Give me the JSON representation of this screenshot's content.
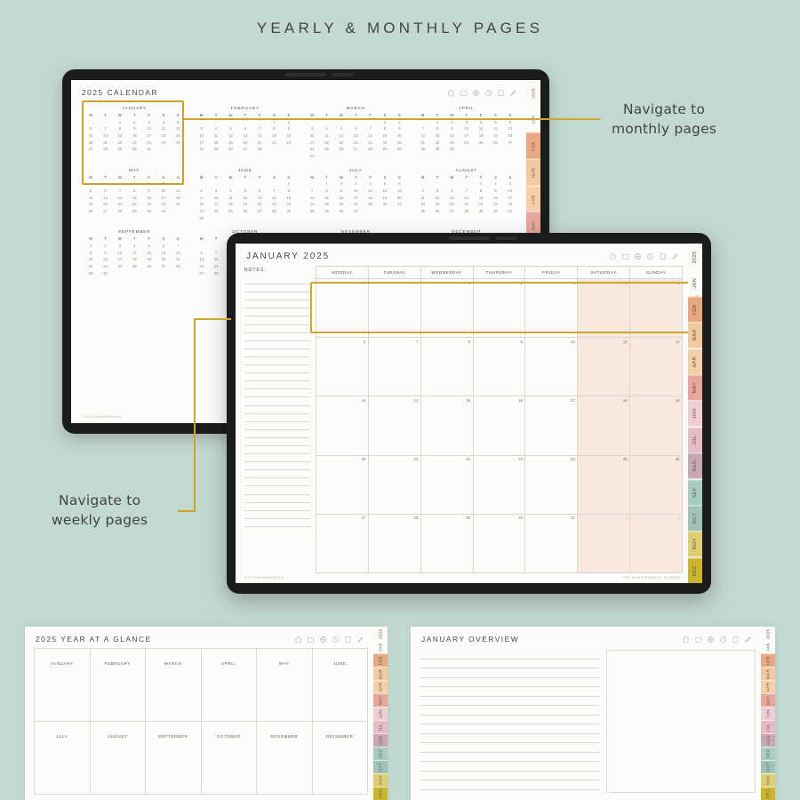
{
  "page": {
    "title": "YEARLY & MONTHLY PAGES",
    "bg_color": "#c3d9d0",
    "accent_gold": "#c9a227",
    "weekend_tint": "#f9e8de"
  },
  "callouts": [
    {
      "line1": "Navigate to",
      "line2": "monthly pages"
    },
    {
      "line1": "Navigate to",
      "line2": "weekly pages"
    }
  ],
  "toolbar_icons": [
    "home-icon",
    "note-icon",
    "globe-icon",
    "clock-icon",
    "book-icon",
    "pencil-icon"
  ],
  "month_tabs": [
    {
      "label": "2025",
      "color": "#fbf9f4"
    },
    {
      "label": "JAN",
      "color": "#fdfcf7"
    },
    {
      "label": "FEB",
      "color": "#e8a882"
    },
    {
      "label": "MAR",
      "color": "#f2c9a0"
    },
    {
      "label": "APR",
      "color": "#f6cfa8"
    },
    {
      "label": "MAY",
      "color": "#e8a79a"
    },
    {
      "label": "JUN",
      "color": "#eecdd4"
    },
    {
      "label": "JUL",
      "color": "#e6bcc6"
    },
    {
      "label": "AUG",
      "color": "#c8a7b4"
    },
    {
      "label": "SEP",
      "color": "#a8ccc2"
    },
    {
      "label": "OCT",
      "color": "#9fc3b8"
    },
    {
      "label": "NOV",
      "color": "#e0cf72"
    },
    {
      "label": "DEC",
      "color": "#cbb42e"
    }
  ],
  "yearly_page": {
    "title": "2025 CALENDAR",
    "copyright": "© SYLVIA MASCHELLA",
    "dow": [
      "M",
      "T",
      "W",
      "T",
      "F",
      "S",
      "S"
    ],
    "months": [
      {
        "name": "JANUARY",
        "lead": 2,
        "days": 31
      },
      {
        "name": "FEBRUARY",
        "lead": 5,
        "days": 28
      },
      {
        "name": "MARCH",
        "lead": 5,
        "days": 31
      },
      {
        "name": "APRIL",
        "lead": 1,
        "days": 30
      },
      {
        "name": "MAY",
        "lead": 3,
        "days": 31
      },
      {
        "name": "JUNE",
        "lead": 6,
        "days": 30
      },
      {
        "name": "JULY",
        "lead": 1,
        "days": 31
      },
      {
        "name": "AUGUST",
        "lead": 4,
        "days": 31
      },
      {
        "name": "SEPTEMBER",
        "lead": 0,
        "days": 30
      },
      {
        "name": "OCTOBER",
        "lead": 2,
        "days": 31
      },
      {
        "name": "NOVEMBER",
        "lead": 5,
        "days": 30
      },
      {
        "name": "DECEMBER",
        "lead": 0,
        "days": 31
      }
    ]
  },
  "monthly_page": {
    "title": "JANUARY 2025",
    "notes_label": "NOTES:",
    "notes_line_count": 31,
    "copyright": "© SYLVIA MASCHELLA",
    "brand": "THE QUINTESSENTIAL PLANNER",
    "dow": [
      "MONDAY",
      "TUESDAY",
      "WEDNESDAY",
      "THURSDAY",
      "FRIDAY",
      "SATURDAY",
      "SUNDAY"
    ],
    "weeks": [
      [
        {
          "d": 30,
          "out": true
        },
        {
          "d": 31,
          "out": true
        },
        {
          "d": 1
        },
        {
          "d": 2
        },
        {
          "d": 3
        },
        {
          "d": 4,
          "we": true
        },
        {
          "d": 5,
          "we": true
        }
      ],
      [
        {
          "d": 6
        },
        {
          "d": 7
        },
        {
          "d": 8
        },
        {
          "d": 9
        },
        {
          "d": 10
        },
        {
          "d": 11,
          "we": true
        },
        {
          "d": 12,
          "we": true
        }
      ],
      [
        {
          "d": 13
        },
        {
          "d": 14
        },
        {
          "d": 15
        },
        {
          "d": 16
        },
        {
          "d": 17
        },
        {
          "d": 18,
          "we": true
        },
        {
          "d": 19,
          "we": true
        }
      ],
      [
        {
          "d": 20
        },
        {
          "d": 21
        },
        {
          "d": 22
        },
        {
          "d": 23
        },
        {
          "d": 24
        },
        {
          "d": 25,
          "we": true
        },
        {
          "d": 26,
          "we": true
        }
      ],
      [
        {
          "d": 27
        },
        {
          "d": 28
        },
        {
          "d": 29
        },
        {
          "d": 30
        },
        {
          "d": 31
        },
        {
          "d": 1,
          "we": true,
          "out": true
        },
        {
          "d": 2,
          "we": true,
          "out": true
        }
      ]
    ]
  },
  "year_at_a_glance": {
    "title": "2025 YEAR AT A GLANCE",
    "months": [
      "JANUARY",
      "FEBRUARY",
      "MARCH",
      "APRIL",
      "MAY",
      "JUNE",
      "JULY",
      "AUGUST",
      "SEPTEMBER",
      "OCTOBER",
      "NOVEMBER",
      "DECEMBER"
    ]
  },
  "january_overview": {
    "title": "JANUARY OVERVIEW",
    "line_count": 15
  }
}
